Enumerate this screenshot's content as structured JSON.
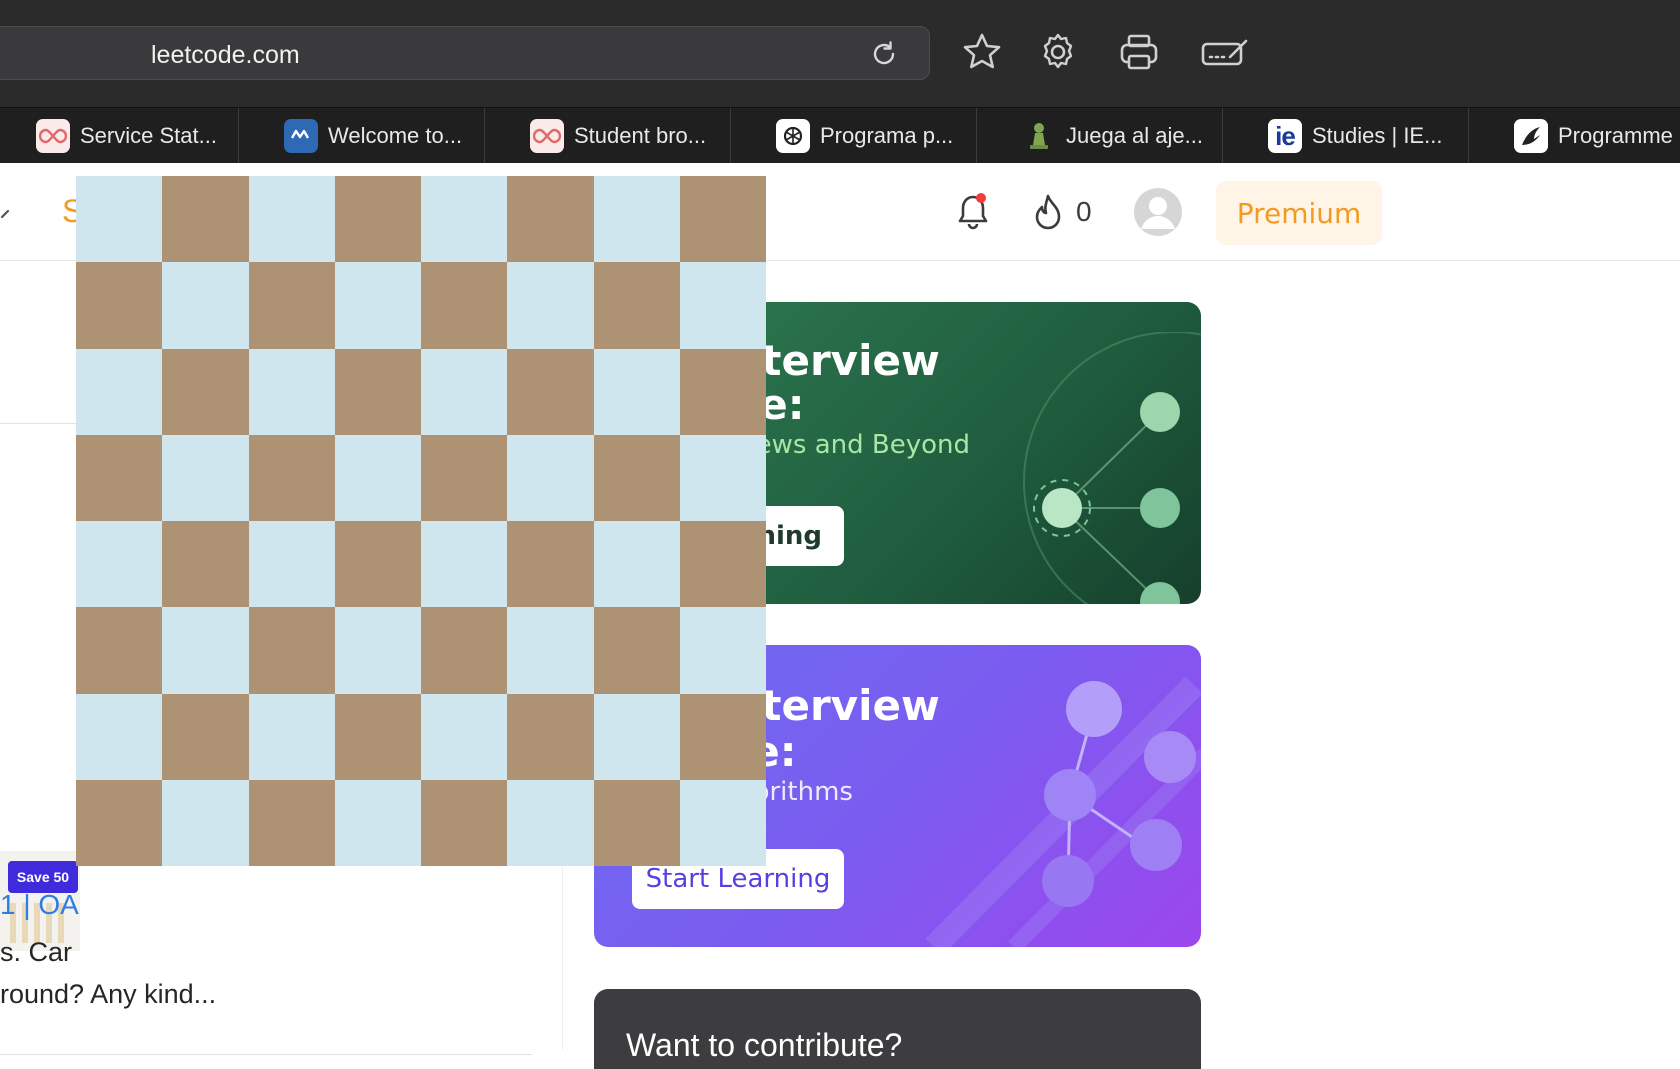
{
  "browser": {
    "url": "leetcode.com",
    "tabs": [
      {
        "label": "Service Stat...",
        "icon": "infinity-icon"
      },
      {
        "label": "Welcome to...",
        "icon": "app-logo-icon"
      },
      {
        "label": "Student bro...",
        "icon": "infinity-icon"
      },
      {
        "label": "Programa p...",
        "icon": "openai-icon"
      },
      {
        "label": "Juega al aje...",
        "icon": "chess-pawn-icon"
      },
      {
        "label": "Studies | IE...",
        "icon": "ie-logo-icon"
      },
      {
        "label": "Programme",
        "icon": "app-logo-icon"
      }
    ]
  },
  "header": {
    "partial_nav_text": "S",
    "streak_count": "0",
    "premium_label": "Premium"
  },
  "banners": [
    {
      "title_line1": "ode's Interview",
      "title_line2": "Course:",
      "subtitle": "sign for Interviews and Beyond",
      "button_label": "rning"
    },
    {
      "title_line1": "ode's Interview",
      "title_line2": "Course:",
      "subtitle": "ctures and Algorithms",
      "button_label": "Start Learning"
    }
  ],
  "contribute": {
    "text": "Want to contribute?"
  },
  "left_column": {
    "promo_badge": "Save 50",
    "post_title_fragment": "1 | OA",
    "post_excerpt_line1": "s. Car",
    "post_excerpt_line2": "round? Any kind..."
  },
  "colors": {
    "accent": "#f39a22",
    "checker_light": "#d0e6ef",
    "checker_dark": "#ad9373"
  }
}
